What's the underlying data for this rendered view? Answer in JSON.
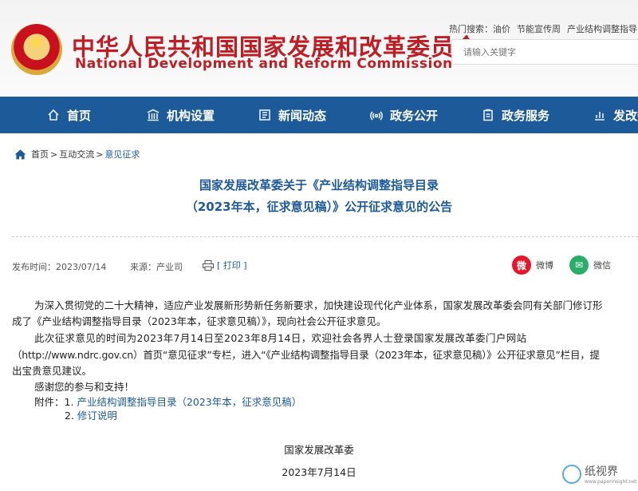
{
  "header": {
    "title_cn": "中华人民共和国国家发展和改革委员会",
    "title_en": "National Development and Reform Commission",
    "hot_search_label": "热门搜索：",
    "hot_links": [
      "油价",
      "节能宣传周",
      "产业结构调整指导"
    ],
    "search_placeholder": "请输入关键字"
  },
  "nav": {
    "items": [
      {
        "label": "首页",
        "icon": "home-icon"
      },
      {
        "label": "机构设置",
        "icon": "building-icon"
      },
      {
        "label": "新闻动态",
        "icon": "news-icon"
      },
      {
        "label": "政务公开",
        "icon": "broadcast-icon"
      },
      {
        "label": "政务服务",
        "icon": "clipboard-icon"
      },
      {
        "label": "发改数",
        "icon": "chart-icon"
      }
    ]
  },
  "breadcrumb": {
    "home": "首页",
    "sep": ">",
    "level1": "互动交流",
    "level2": "意见征求"
  },
  "article": {
    "title_line1": "国家发展改革委关于《产业结构调整指导目录",
    "title_line2": "（2023年本，征求意见稿）》公开征求意见的公告",
    "publish_time": "发布时间：2023/07/14",
    "source": "来源：产业司",
    "print_label": "[ 打印 ]",
    "share_weibo": "微博",
    "share_wechat": "微信",
    "para1_line1": "为深入贯彻党的二十大精神，适应产业发展新形势新任务新要求，加快建设现代化产业体系，国家发展改革委会同有关部门修订形",
    "para1_line2": "成了《产业结构调整指导目录（2023年本，征求意见稿）》，现向社会公开征求意见。",
    "para2_line1": "此次征求意见的时间为2023年7月14日至2023年8月14日，欢迎社会各界人士登录国家发展改革委门户网站",
    "para2_line2": "（http://www.ndrc.gov.cn）首页“意见征求”专栏，进入“《产业结构调整指导目录（2023年本，征求意见稿）》公开征求意见”栏目，提",
    "para2_line3": "出宝贵意见建议。",
    "thanks": "感谢您的参与和支持！",
    "attachments_label": "附件：",
    "attachment1_num": "1.",
    "attachment1": "产业结构调整指导目录（2023年本，征求意见稿）",
    "attachment2_num": "2.",
    "attachment2": "修订说明",
    "signature": "国家发展改革委",
    "date": "2023年7月14日"
  },
  "watermark": {
    "text": "纸视界",
    "url": "www.paperinsight.net"
  },
  "colors": {
    "brand_red": "#be1e23",
    "nav_blue": "#1d5a99",
    "weibo_red": "#e6162d",
    "wechat_green": "#2aae67"
  }
}
